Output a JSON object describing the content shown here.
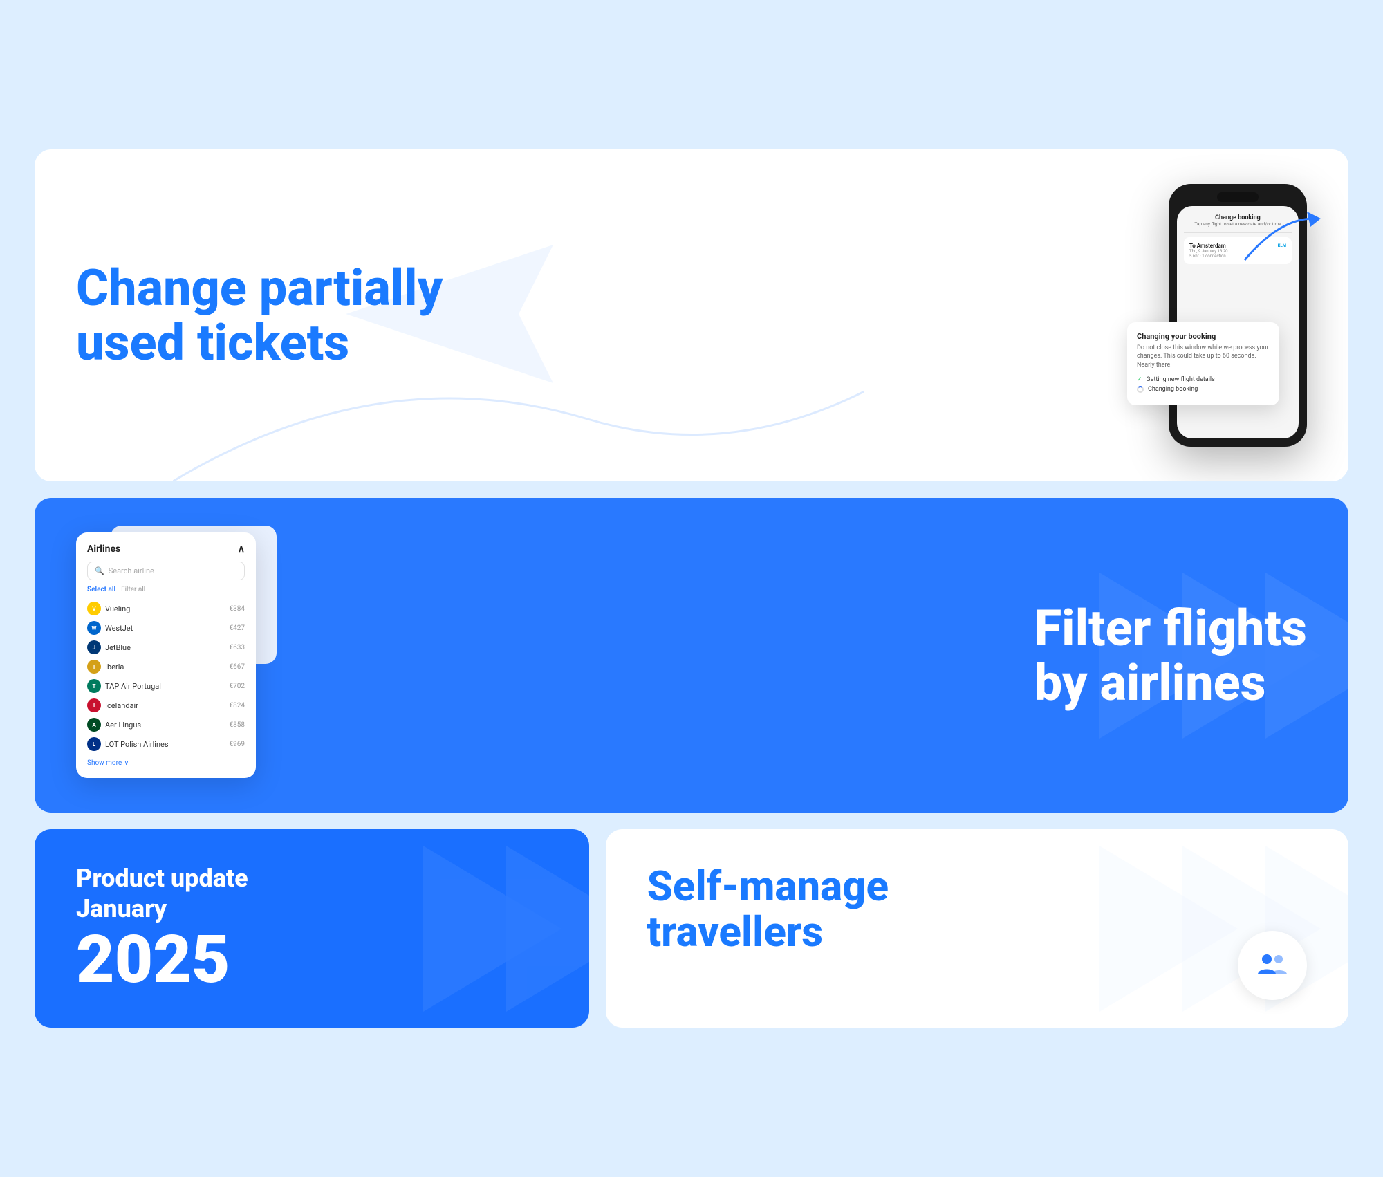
{
  "card1": {
    "title_line1": "Change partially",
    "title_line2": "used tickets",
    "phone": {
      "dialog_title": "Change booking",
      "dialog_subtitle": "Tap any flight to set a new date and/or time",
      "flight_dest": "To Amsterdam",
      "flight_date": "Thu, 9 January 13:20",
      "flight_info": "5.6hr · 1 connection",
      "popup_title": "Changing your booking",
      "popup_desc": "Do not close this window while we process your changes. This could take up to 60 seconds. Nearly there!",
      "popup_step1": "Getting new flight details",
      "popup_step2": "Changing booking"
    }
  },
  "card2": {
    "title_line1": "Filter flights",
    "title_line2": "by airlines",
    "airlines_panel": {
      "title": "Airlines",
      "search_placeholder": "Search airline",
      "select_all": "Select all",
      "filter_all": "Filter all",
      "airlines": [
        {
          "name": "Vueling",
          "price": "€384",
          "color": "#ffcc00"
        },
        {
          "name": "WestJet",
          "price": "€427",
          "color": "#0066cc"
        },
        {
          "name": "JetBlue",
          "price": "€633",
          "color": "#003876"
        },
        {
          "name": "Iberia",
          "price": "€667",
          "color": "#d4a017"
        },
        {
          "name": "TAP Air Portugal",
          "price": "€702",
          "color": "#007b5e"
        },
        {
          "name": "Icelandair",
          "price": "€824",
          "color": "#c8102e"
        },
        {
          "name": "Aer Lingus",
          "price": "€858",
          "color": "#004b23"
        },
        {
          "name": "LOT Polish Airlines",
          "price": "€969",
          "color": "#003087"
        }
      ],
      "show_more": "Show more"
    }
  },
  "card3": {
    "subtitle_line1": "Product update",
    "subtitle_line2": "January",
    "year": "2025"
  },
  "card4": {
    "title_line1": "Self-manage",
    "title_line2": "travellers"
  }
}
